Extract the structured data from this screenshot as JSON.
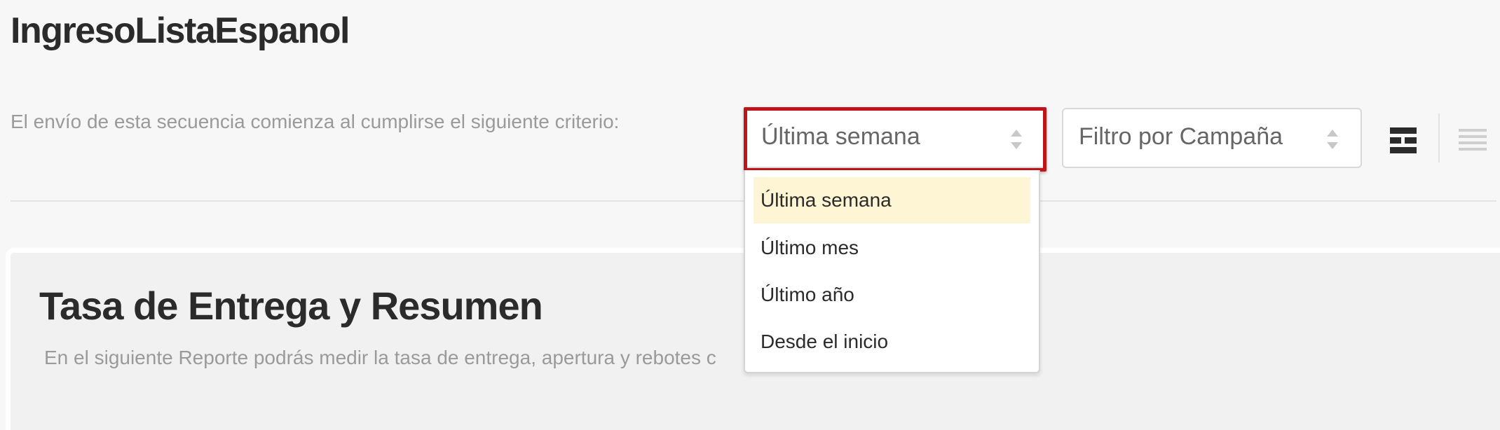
{
  "page": {
    "title": "IngresoListaEspanol"
  },
  "criteria": {
    "label": "El envío de esta secuencia comienza al cumplirse el siguiente criterio:"
  },
  "period_select": {
    "selected": "Última semana",
    "options": [
      "Última semana",
      "Último mes",
      "Último año",
      "Desde el inicio"
    ],
    "highlighted_option": "Última semana"
  },
  "campaign_select": {
    "placeholder": "Filtro por Campaña"
  },
  "view_toggle": {
    "grid_icon": "grid-view-icon",
    "list_icon": "list-view-icon"
  },
  "report": {
    "title": "Tasa de Entrega y Resumen",
    "description": "En el siguiente Reporte podrás medir la tasa de entrega, apertura y rebotes c"
  },
  "colors": {
    "highlight_border": "#c0141b",
    "active_option_bg": "#fdf5d3",
    "text_dark": "#2b2b2b",
    "text_muted": "#9a9a9a"
  }
}
